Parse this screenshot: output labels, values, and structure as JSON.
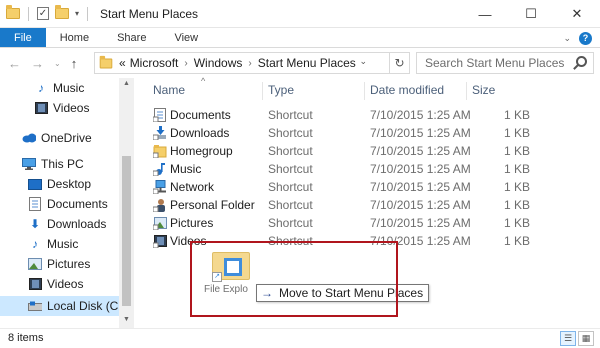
{
  "window": {
    "title": "Start Menu Places",
    "controls": {
      "minimize": "—",
      "maximize": "☐",
      "close": "✕"
    }
  },
  "ribbon": {
    "tabs": [
      "File",
      "Home",
      "Share",
      "View"
    ],
    "active_color": "#1979ca",
    "help": "?"
  },
  "address_bar": {
    "prefix": "«",
    "crumbs": [
      "Microsoft",
      "Windows",
      "Start Menu Places"
    ],
    "search_placeholder": "Search Start Menu Places"
  },
  "nav_pane": {
    "items": [
      {
        "label": "Music",
        "icon": "music-icon"
      },
      {
        "label": "Videos",
        "icon": "video-icon"
      },
      {
        "label": "OneDrive",
        "icon": "cloud-icon"
      },
      {
        "label": "This PC",
        "icon": "computer-icon"
      },
      {
        "label": "Desktop",
        "icon": "desktop-icon"
      },
      {
        "label": "Documents",
        "icon": "documents-icon"
      },
      {
        "label": "Downloads",
        "icon": "downloads-icon"
      },
      {
        "label": "Music",
        "icon": "music-icon"
      },
      {
        "label": "Pictures",
        "icon": "pictures-icon"
      },
      {
        "label": "Videos",
        "icon": "video-icon"
      },
      {
        "label": "Local Disk (C:)",
        "icon": "disk-icon",
        "selected": true
      }
    ]
  },
  "columns": {
    "name": "Name",
    "type": "Type",
    "date": "Date modified",
    "size": "Size"
  },
  "files": [
    {
      "name": "Documents",
      "type": "Shortcut",
      "date": "7/10/2015 1:25 AM",
      "size": "1 KB",
      "icon": "documents-icon"
    },
    {
      "name": "Downloads",
      "type": "Shortcut",
      "date": "7/10/2015 1:25 AM",
      "size": "1 KB",
      "icon": "downloads-icon"
    },
    {
      "name": "Homegroup",
      "type": "Shortcut",
      "date": "7/10/2015 1:25 AM",
      "size": "1 KB",
      "icon": "homegroup-icon"
    },
    {
      "name": "Music",
      "type": "Shortcut",
      "date": "7/10/2015 1:25 AM",
      "size": "1 KB",
      "icon": "music-icon"
    },
    {
      "name": "Network",
      "type": "Shortcut",
      "date": "7/10/2015 1:25 AM",
      "size": "1 KB",
      "icon": "network-icon"
    },
    {
      "name": "Personal Folder",
      "type": "Shortcut",
      "date": "7/10/2015 1:25 AM",
      "size": "1 KB",
      "icon": "user-icon"
    },
    {
      "name": "Pictures",
      "type": "Shortcut",
      "date": "7/10/2015 1:25 AM",
      "size": "1 KB",
      "icon": "pictures-icon"
    },
    {
      "name": "Videos",
      "type": "Shortcut",
      "date": "7/10/2015 1:25 AM",
      "size": "1 KB",
      "icon": "video-icon"
    }
  ],
  "drag": {
    "item_label": "File Explo",
    "tooltip": "Move to Start Menu Places",
    "highlight_color": "#b0151d"
  },
  "status": {
    "items": "8 items"
  }
}
